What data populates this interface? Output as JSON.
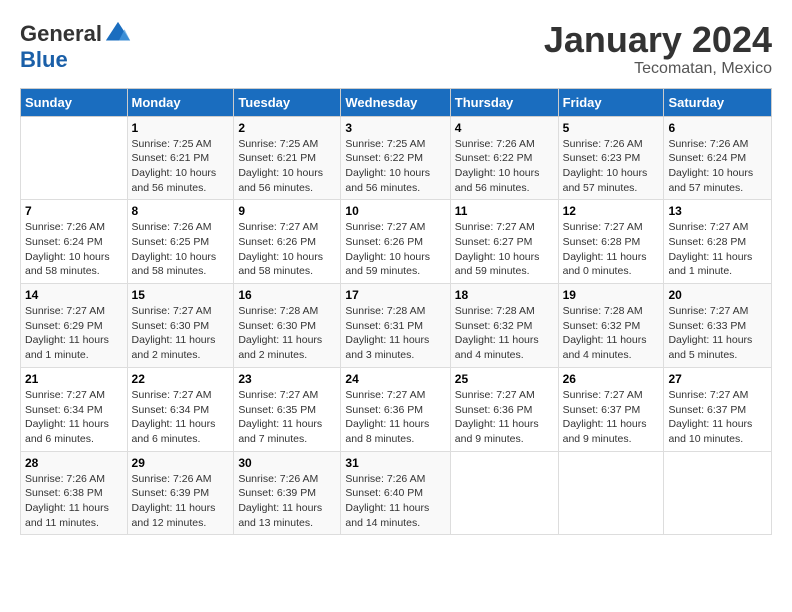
{
  "logo": {
    "general": "General",
    "blue": "Blue"
  },
  "title": "January 2024",
  "subtitle": "Tecomatan, Mexico",
  "days_header": [
    "Sunday",
    "Monday",
    "Tuesday",
    "Wednesday",
    "Thursday",
    "Friday",
    "Saturday"
  ],
  "weeks": [
    [
      {
        "num": "",
        "sunrise": "",
        "sunset": "",
        "daylight": ""
      },
      {
        "num": "1",
        "sunrise": "Sunrise: 7:25 AM",
        "sunset": "Sunset: 6:21 PM",
        "daylight": "Daylight: 10 hours and 56 minutes."
      },
      {
        "num": "2",
        "sunrise": "Sunrise: 7:25 AM",
        "sunset": "Sunset: 6:21 PM",
        "daylight": "Daylight: 10 hours and 56 minutes."
      },
      {
        "num": "3",
        "sunrise": "Sunrise: 7:25 AM",
        "sunset": "Sunset: 6:22 PM",
        "daylight": "Daylight: 10 hours and 56 minutes."
      },
      {
        "num": "4",
        "sunrise": "Sunrise: 7:26 AM",
        "sunset": "Sunset: 6:22 PM",
        "daylight": "Daylight: 10 hours and 56 minutes."
      },
      {
        "num": "5",
        "sunrise": "Sunrise: 7:26 AM",
        "sunset": "Sunset: 6:23 PM",
        "daylight": "Daylight: 10 hours and 57 minutes."
      },
      {
        "num": "6",
        "sunrise": "Sunrise: 7:26 AM",
        "sunset": "Sunset: 6:24 PM",
        "daylight": "Daylight: 10 hours and 57 minutes."
      }
    ],
    [
      {
        "num": "7",
        "sunrise": "Sunrise: 7:26 AM",
        "sunset": "Sunset: 6:24 PM",
        "daylight": "Daylight: 10 hours and 58 minutes."
      },
      {
        "num": "8",
        "sunrise": "Sunrise: 7:26 AM",
        "sunset": "Sunset: 6:25 PM",
        "daylight": "Daylight: 10 hours and 58 minutes."
      },
      {
        "num": "9",
        "sunrise": "Sunrise: 7:27 AM",
        "sunset": "Sunset: 6:26 PM",
        "daylight": "Daylight: 10 hours and 58 minutes."
      },
      {
        "num": "10",
        "sunrise": "Sunrise: 7:27 AM",
        "sunset": "Sunset: 6:26 PM",
        "daylight": "Daylight: 10 hours and 59 minutes."
      },
      {
        "num": "11",
        "sunrise": "Sunrise: 7:27 AM",
        "sunset": "Sunset: 6:27 PM",
        "daylight": "Daylight: 10 hours and 59 minutes."
      },
      {
        "num": "12",
        "sunrise": "Sunrise: 7:27 AM",
        "sunset": "Sunset: 6:28 PM",
        "daylight": "Daylight: 11 hours and 0 minutes."
      },
      {
        "num": "13",
        "sunrise": "Sunrise: 7:27 AM",
        "sunset": "Sunset: 6:28 PM",
        "daylight": "Daylight: 11 hours and 1 minute."
      }
    ],
    [
      {
        "num": "14",
        "sunrise": "Sunrise: 7:27 AM",
        "sunset": "Sunset: 6:29 PM",
        "daylight": "Daylight: 11 hours and 1 minute."
      },
      {
        "num": "15",
        "sunrise": "Sunrise: 7:27 AM",
        "sunset": "Sunset: 6:30 PM",
        "daylight": "Daylight: 11 hours and 2 minutes."
      },
      {
        "num": "16",
        "sunrise": "Sunrise: 7:28 AM",
        "sunset": "Sunset: 6:30 PM",
        "daylight": "Daylight: 11 hours and 2 minutes."
      },
      {
        "num": "17",
        "sunrise": "Sunrise: 7:28 AM",
        "sunset": "Sunset: 6:31 PM",
        "daylight": "Daylight: 11 hours and 3 minutes."
      },
      {
        "num": "18",
        "sunrise": "Sunrise: 7:28 AM",
        "sunset": "Sunset: 6:32 PM",
        "daylight": "Daylight: 11 hours and 4 minutes."
      },
      {
        "num": "19",
        "sunrise": "Sunrise: 7:28 AM",
        "sunset": "Sunset: 6:32 PM",
        "daylight": "Daylight: 11 hours and 4 minutes."
      },
      {
        "num": "20",
        "sunrise": "Sunrise: 7:27 AM",
        "sunset": "Sunset: 6:33 PM",
        "daylight": "Daylight: 11 hours and 5 minutes."
      }
    ],
    [
      {
        "num": "21",
        "sunrise": "Sunrise: 7:27 AM",
        "sunset": "Sunset: 6:34 PM",
        "daylight": "Daylight: 11 hours and 6 minutes."
      },
      {
        "num": "22",
        "sunrise": "Sunrise: 7:27 AM",
        "sunset": "Sunset: 6:34 PM",
        "daylight": "Daylight: 11 hours and 6 minutes."
      },
      {
        "num": "23",
        "sunrise": "Sunrise: 7:27 AM",
        "sunset": "Sunset: 6:35 PM",
        "daylight": "Daylight: 11 hours and 7 minutes."
      },
      {
        "num": "24",
        "sunrise": "Sunrise: 7:27 AM",
        "sunset": "Sunset: 6:36 PM",
        "daylight": "Daylight: 11 hours and 8 minutes."
      },
      {
        "num": "25",
        "sunrise": "Sunrise: 7:27 AM",
        "sunset": "Sunset: 6:36 PM",
        "daylight": "Daylight: 11 hours and 9 minutes."
      },
      {
        "num": "26",
        "sunrise": "Sunrise: 7:27 AM",
        "sunset": "Sunset: 6:37 PM",
        "daylight": "Daylight: 11 hours and 9 minutes."
      },
      {
        "num": "27",
        "sunrise": "Sunrise: 7:27 AM",
        "sunset": "Sunset: 6:37 PM",
        "daylight": "Daylight: 11 hours and 10 minutes."
      }
    ],
    [
      {
        "num": "28",
        "sunrise": "Sunrise: 7:26 AM",
        "sunset": "Sunset: 6:38 PM",
        "daylight": "Daylight: 11 hours and 11 minutes."
      },
      {
        "num": "29",
        "sunrise": "Sunrise: 7:26 AM",
        "sunset": "Sunset: 6:39 PM",
        "daylight": "Daylight: 11 hours and 12 minutes."
      },
      {
        "num": "30",
        "sunrise": "Sunrise: 7:26 AM",
        "sunset": "Sunset: 6:39 PM",
        "daylight": "Daylight: 11 hours and 13 minutes."
      },
      {
        "num": "31",
        "sunrise": "Sunrise: 7:26 AM",
        "sunset": "Sunset: 6:40 PM",
        "daylight": "Daylight: 11 hours and 14 minutes."
      },
      {
        "num": "",
        "sunrise": "",
        "sunset": "",
        "daylight": ""
      },
      {
        "num": "",
        "sunrise": "",
        "sunset": "",
        "daylight": ""
      },
      {
        "num": "",
        "sunrise": "",
        "sunset": "",
        "daylight": ""
      }
    ]
  ]
}
